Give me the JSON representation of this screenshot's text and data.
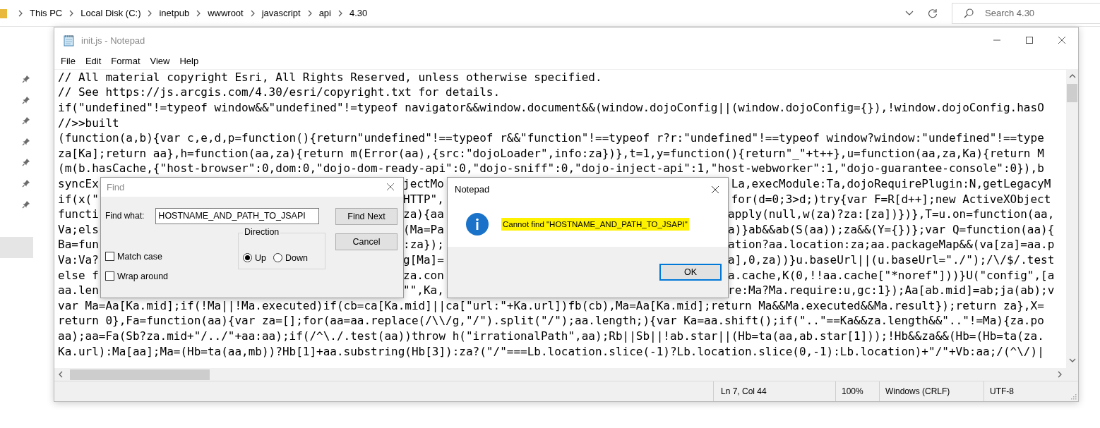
{
  "breadcrumb": [
    "This PC",
    "Local Disk (C:)",
    "inetpub",
    "wwwroot",
    "javascript",
    "api",
    "4.30"
  ],
  "search": {
    "placeholder": "Search 4.30"
  },
  "window": {
    "title": "init.js - Notepad",
    "active": false
  },
  "menu": [
    "File",
    "Edit",
    "Format",
    "View",
    "Help"
  ],
  "code_lines": [
    {
      "segments": [
        "// All material copyright Esri, All Rights Reserved, unless otherwise specified."
      ]
    },
    {
      "segments": [
        "// See https://js.arcgis.com/4.30/esri/copyright.txt for details."
      ]
    },
    {
      "segments": [
        "if(\"undefined\"!=typeof window&&\"undefined\"!=typeof navigator&&window.document&&(window.dojoConfig||(window.dojoConfig={}),!window.dojoConfig.hasO"
      ]
    },
    {
      "segments": [
        "//>>built"
      ]
    },
    {
      "segments": [
        "(function(a,b){var c,e,d,p=function(){return\"undefined\"!==typeof r&&\"function\"!==typeof r?r:\"undefined\"!==typeof window?window:\"undefined\"!==type"
      ]
    },
    {
      "segments": [
        "za[Ka];return aa},h=function(aa,za){return m(Error(aa),{src:\"dojoLoader\",info:za})},t=1,y=function(){return\"_\"+t++},u=function(aa,za,Ka){return M"
      ]
    },
    {
      "segments": [
        "(m(b.hasCache,{\"host-browser\":0,dom:0,\"dojo-dom-ready-api\":0,\"dojo-sniff\":0,\"dojo-inject-api\":1,\"host-webworker\":1,\"dojo-guarantee-console\":0}),b"
      ]
    },
    {
      "segments": [
        "syncEx",
        "jectMo",
        "La,execModule:Ta,dojoRequirePlugin:N,getLegacyM"
      ]
    },
    {
      "segments": [
        "if(x(\"",
        "HTTP\",",
        "for(d=0;3>d;)try{var F=R[d++];new ActiveXObject"
      ]
    },
    {
      "segments": [
        "functi",
        "za){aa",
        "apply(null,w(za)?za:[za])})},T=u.on=function(aa,"
      ]
    },
    {
      "segments": [
        "Va;els",
        "(Ma=Pa",
        "a)}ab&&ab(S(aa));za&&(Y={})};var Q=function(aa){"
      ]
    },
    {
      "segments": [
        "Ba=fun",
        ":za});",
        "ation?aa.location:za;aa.packageMap&&(va[za]=aa.p"
      ]
    },
    {
      "segments": [
        "Va:Va?",
        "g[Ma]=",
        "a],0,za))}u.baseUrl||(u.baseUrl=\"./\");/\\/$/.test"
      ]
    },
    {
      "segments": [
        "else f",
        "za.con",
        "a.cache,K(0,!!aa.cache[\"*noref\"]))}U(\"config\",[a"
      ]
    },
    {
      "segments": [
        "aa.len",
        "\"\",Ka,",
        "re:Ma?Ma.require:u,gc:1});Aa[ab.mid]=ab;ja(ab);v"
      ]
    },
    {
      "segments": [
        "var Ma=Aa[Ka.mid];if(!Ma||!Ma.executed)if(cb=ca[Ka.mid]||ca[\"url:\"+Ka.url])fb(cb),Ma=Aa[Ka.mid];return Ma&&Ma.executed&&Ma.result});return za},X="
      ]
    },
    {
      "segments": [
        "return 0},Fa=function(aa){var za=[];for(aa=aa.replace(/\\\\/g,\"/\").split(\"/\");aa.length;){var Ka=aa.shift();if(\"..\"==Ka&&za.length&&\"..\"!=Ma){za.po"
      ]
    },
    {
      "segments": [
        "aa);aa=Fa(Sb?za.mid+\"/../\"+aa:aa);if(/^\\./.test(aa))throw h(\"irrationalPath\",aa);Rb||Sb||!ab.star||(Hb=ta(aa,ab.star[1]));!Hb&&za&&(Hb=(Hb=ta(za."
      ]
    },
    {
      "segments": [
        "Ka.url):Ma[aa];Ma=(Hb=ta(aa,mb))?Hb[1]+aa.substring(Hb[3]):za?(\"/\"===Lb.location.slice(-1)?Lb.location.slice(0,-1):Lb.location)+\"/\"+Vb:aa;/(^\\/)|"
      ]
    }
  ],
  "status_bar": {
    "position": "Ln 7, Col 44",
    "zoom": "100%",
    "line_ending": "Windows (CRLF)",
    "encoding": "UTF-8"
  },
  "find_dialog": {
    "title": "Find",
    "find_what_label": "Find what:",
    "find_what_value": "HOSTNAME_AND_PATH_TO_JSAPI",
    "buttons": [
      "Find Next",
      "Cancel"
    ],
    "direction": {
      "label": "Direction",
      "options": [
        {
          "label": "Up",
          "selected": true
        },
        {
          "label": "Down",
          "selected": false
        }
      ]
    },
    "checkboxes": [
      {
        "label": "Match case",
        "checked": false
      },
      {
        "label": "Wrap around",
        "checked": false
      }
    ]
  },
  "message_box": {
    "title": "Notepad",
    "message": "Cannot find \"HOSTNAME_AND_PATH_TO_JSAPI\"",
    "highlighted": true,
    "button": "OK"
  }
}
